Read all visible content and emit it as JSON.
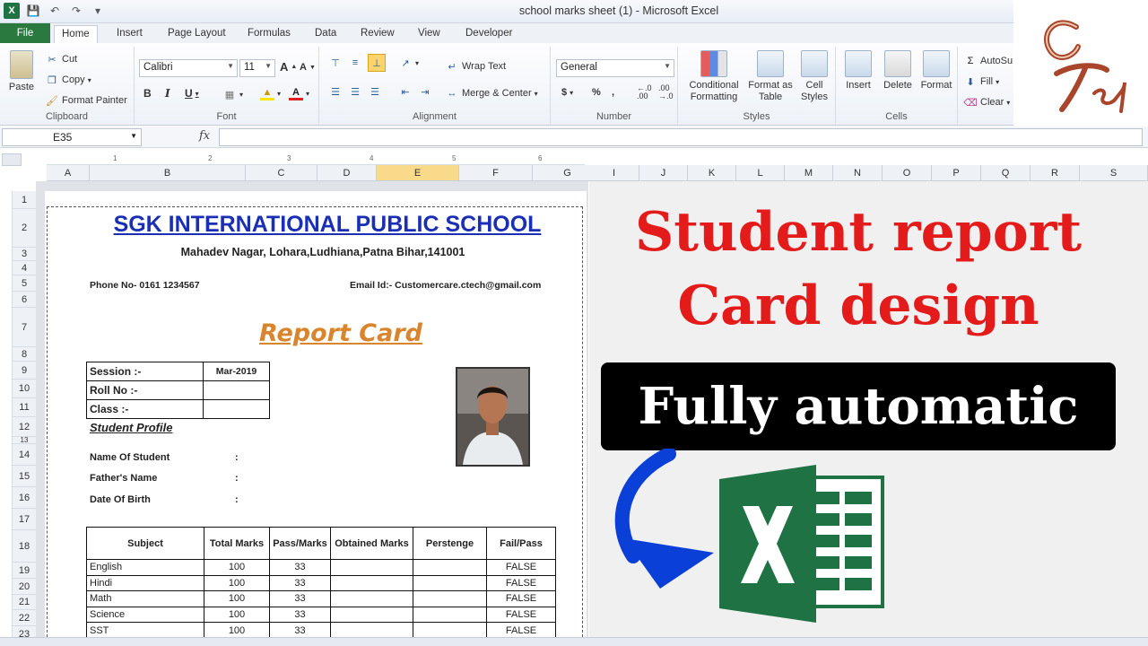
{
  "window": {
    "title": "school marks sheet (1)  -  Microsoft Excel"
  },
  "tabs": [
    "File",
    "Home",
    "Insert",
    "Page Layout",
    "Formulas",
    "Data",
    "Review",
    "View",
    "Developer"
  ],
  "ribbon": {
    "clipboard": {
      "paste": "Paste",
      "cut": "Cut",
      "copy": "Copy",
      "format_painter": "Format Painter",
      "label": "Clipboard"
    },
    "font": {
      "name": "Calibri",
      "size": "11",
      "label": "Font"
    },
    "alignment": {
      "wrap": "Wrap Text",
      "merge": "Merge & Center",
      "label": "Alignment"
    },
    "number": {
      "format": "General",
      "label": "Number"
    },
    "styles": {
      "conditional": "Conditional Formatting",
      "table": "Format as Table",
      "cell": "Cell Styles",
      "label": "Styles"
    },
    "cells": {
      "insert": "Insert",
      "delete": "Delete",
      "format": "Format",
      "label": "Cells"
    },
    "editing": {
      "autosum": "AutoSu",
      "fill": "Fill",
      "clear": "Clear"
    }
  },
  "formula_bar": {
    "name_box": "E35",
    "fx": "fx"
  },
  "columns_left": [
    "A",
    "B",
    "C",
    "D",
    "E",
    "F",
    "G",
    "H"
  ],
  "columns_right": [
    "I",
    "J",
    "K",
    "L",
    "M",
    "N",
    "O",
    "P",
    "Q",
    "R",
    "S"
  ],
  "rows": [
    "1",
    "2",
    "3",
    "4",
    "5",
    "6",
    "7",
    "8",
    "9",
    "10",
    "11",
    "12",
    "13",
    "14",
    "15",
    "16",
    "17",
    "18",
    "19",
    "20",
    "21",
    "22",
    "23"
  ],
  "ruler_ticks": [
    "1",
    "2",
    "3",
    "4",
    "5",
    "6"
  ],
  "report": {
    "school": "SGK INTERNATIONAL PUBLIC SCHOOL",
    "address": "Mahadev Nagar, Lohara,Ludhiana,Patna Bihar,141001",
    "phone": "Phone No- 0161 1234567",
    "email": "Email Id:- Customercare.ctech@gmail.com",
    "title": "Report Card",
    "session_label": "Session :-",
    "session_value": "Mar-2019",
    "roll_label": "Roll No :-",
    "class_label": "Class :-",
    "profile_heading": "Student Profile",
    "profile_fields": [
      "Name Of Student",
      "Father's Name",
      "Date Of Birth"
    ],
    "colon": ":",
    "table_headers": [
      "Subject",
      "Total Marks",
      "Pass/Marks",
      "Obtained Marks",
      "Perstenge",
      "Fail/Pass"
    ],
    "subjects": [
      {
        "name": "English",
        "total": "100",
        "pass": "33",
        "result": "FALSE"
      },
      {
        "name": "Hindi",
        "total": "100",
        "pass": "33",
        "result": "FALSE"
      },
      {
        "name": "Math",
        "total": "100",
        "pass": "33",
        "result": "FALSE"
      },
      {
        "name": "Science",
        "total": "100",
        "pass": "33",
        "result": "FALSE"
      },
      {
        "name": "SST",
        "total": "100",
        "pass": "33",
        "result": "FALSE"
      }
    ]
  },
  "overlay": {
    "line1": "Student report",
    "line2": "Card design",
    "line3": "Fully automatic"
  },
  "colors": {
    "school": "#1b2fb5",
    "title": "#d9852d",
    "headline": "#e31b1b",
    "excel_green": "#1f7244"
  }
}
